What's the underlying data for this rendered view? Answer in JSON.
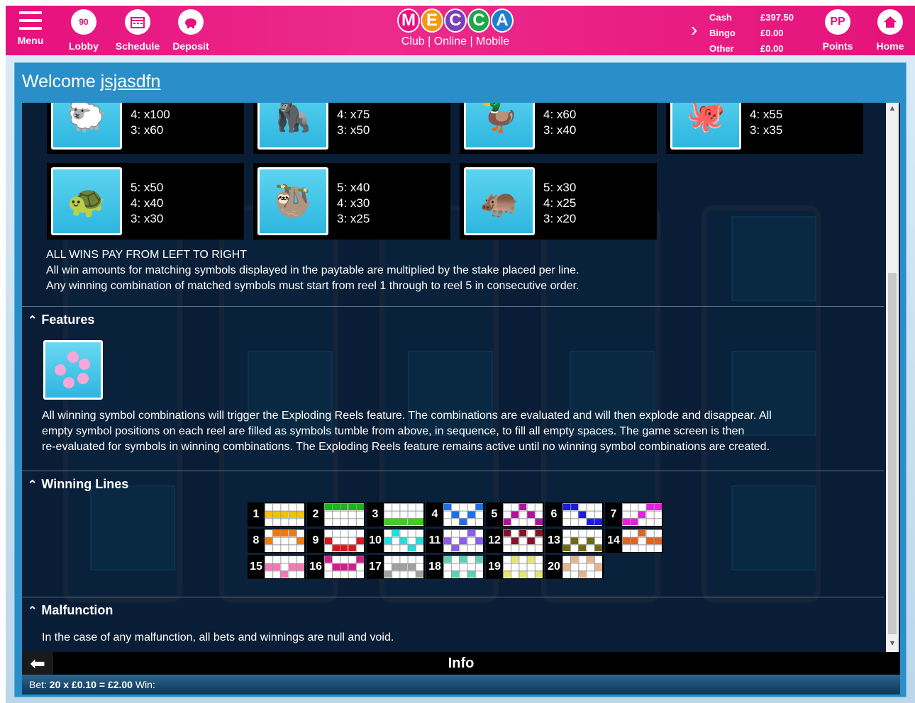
{
  "header": {
    "menu_label": "Menu",
    "lobby_label": "Lobby",
    "schedule_label": "Schedule",
    "deposit_label": "Deposit",
    "logo_letters": [
      "M",
      "E",
      "C",
      "C",
      "A"
    ],
    "logo_sub": "Club | Online | Mobile",
    "balances": [
      {
        "label": "Cash",
        "value": "£397.50"
      },
      {
        "label": "Bingo",
        "value": "£0.00"
      },
      {
        "label": "Other",
        "value": "£0.00"
      }
    ],
    "points_label": "Points",
    "home_label": "Home",
    "lobby_badge": "90",
    "points_badge": "PP"
  },
  "welcome": {
    "prefix": "Welcome ",
    "username": "jsjasdfn"
  },
  "paytable": {
    "top_row": [
      {
        "icon": "sheep-icon",
        "lines": [
          "4: x100",
          "3: x60"
        ]
      },
      {
        "icon": "gorilla-icon",
        "lines": [
          "4: x75",
          "3: x50"
        ]
      },
      {
        "icon": "duck-icon",
        "lines": [
          "4: x60",
          "3: x40"
        ]
      },
      {
        "icon": "octopus-icon",
        "lines": [
          "4: x55",
          "3: x35"
        ]
      }
    ],
    "second_row": [
      {
        "icon": "turtle-icon",
        "lines": [
          "5: x50",
          "4: x40",
          "3: x30"
        ]
      },
      {
        "icon": "sloth-icon",
        "lines": [
          "5: x40",
          "4: x30",
          "3: x25"
        ]
      },
      {
        "icon": "hippo-icon",
        "lines": [
          "5: x30",
          "4: x25",
          "3: x20"
        ]
      }
    ],
    "rules": [
      "ALL WINS PAY FROM LEFT TO RIGHT",
      "All win amounts for matching symbols displayed in the paytable are multiplied by the stake placed per line.",
      "Any winning combination of matched symbols must start from reel 1 through to reel 5 in consecutive order."
    ]
  },
  "features": {
    "title": "Features",
    "text_lines": [
      "All winning symbol combinations will trigger the Exploding Reels feature. The combinations are evaluated and will then explode and disappear. All",
      "empty symbol positions on each reel are filled as symbols tumble from above, in sequence, to fill all empty spaces. The game screen is then",
      "re-evaluated for symbols in winning combinations. The Exploding Reels feature remains active until no winning symbol combinations are created."
    ]
  },
  "winning_lines": {
    "title": "Winning Lines",
    "lines": [
      {
        "n": "1",
        "color": "#f2c200"
      },
      {
        "n": "2",
        "color": "#1bb41b"
      },
      {
        "n": "3",
        "color": "#39d11a"
      },
      {
        "n": "4",
        "color": "#1e6fe6"
      },
      {
        "n": "5",
        "color": "#b0149c"
      },
      {
        "n": "6",
        "color": "#1a1ae0"
      },
      {
        "n": "7",
        "color": "#e81ee0"
      },
      {
        "n": "8",
        "color": "#f07a10"
      },
      {
        "n": "9",
        "color": "#e0141e"
      },
      {
        "n": "10",
        "color": "#1ee0e0"
      },
      {
        "n": "11",
        "color": "#8a5cf0"
      },
      {
        "n": "12",
        "color": "#8a0f2a"
      },
      {
        "n": "13",
        "color": "#6b6b10"
      },
      {
        "n": "14",
        "color": "#e0641e"
      },
      {
        "n": "15",
        "color": "#f07ab4"
      },
      {
        "n": "16",
        "color": "#d21e8c"
      },
      {
        "n": "17",
        "color": "#a0a0a0"
      },
      {
        "n": "18",
        "color": "#5ad2b4"
      },
      {
        "n": "19",
        "color": "#e6e66e"
      },
      {
        "n": "20",
        "color": "#e6b48c"
      }
    ]
  },
  "malfunction": {
    "title": "Malfunction",
    "text": "In the case of any malfunction, all bets and winnings are null and void."
  },
  "infobar": {
    "title": "Info"
  },
  "betbar": {
    "bet_label": "Bet:",
    "bet_value": "20 x £0.10 = £2.00",
    "win_label": "Win:"
  },
  "colors": {
    "brand_pink": "#e6107e",
    "panel_blue": "#2a8fc8"
  }
}
